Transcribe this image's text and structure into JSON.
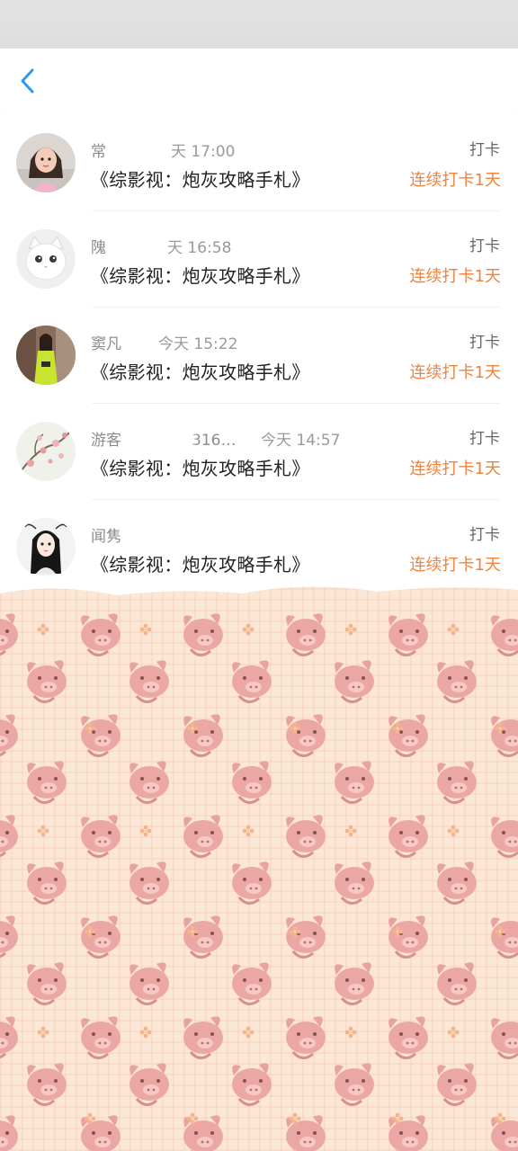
{
  "colors": {
    "accent_blue": "#2f9be6",
    "streak_orange": "#f0823a",
    "wallpaper_base": "#fbe7d6",
    "pig_pink": "#e69a9a"
  },
  "nav": {
    "back_icon": "chevron-left-icon"
  },
  "entries": [
    {
      "name": "常",
      "time": "天 17:00",
      "book": "《综影视：炮灰攻略手札》",
      "type": "打卡",
      "streak": "连续打卡1天",
      "avatar": "girl-photo-avatar"
    },
    {
      "name": "隗",
      "time": "天 16:58",
      "book": "《综影视：炮灰攻略手札》",
      "type": "打卡",
      "streak": "连续打卡1天",
      "avatar": "white-cat-avatar"
    },
    {
      "name": "窦凡",
      "time": "今天 15:22",
      "book": "《综影视：炮灰攻略手札》",
      "type": "打卡",
      "streak": "连续打卡1天",
      "avatar": "green-dress-photo-avatar"
    },
    {
      "name": "游客",
      "name_suffix": "316…",
      "time": "今天 14:57",
      "book": "《综影视：炮灰攻略手札》",
      "type": "打卡",
      "streak": "连续打卡1天",
      "avatar": "plum-blossom-avatar"
    },
    {
      "name": "闻隽",
      "time": "",
      "book": "《综影视：炮灰攻略手札》",
      "type": "打卡",
      "streak": "连续打卡1天",
      "avatar": "illustrated-girl-avatar"
    }
  ],
  "wallpaper": {
    "pattern": "pink-pig-plaid-icon"
  }
}
